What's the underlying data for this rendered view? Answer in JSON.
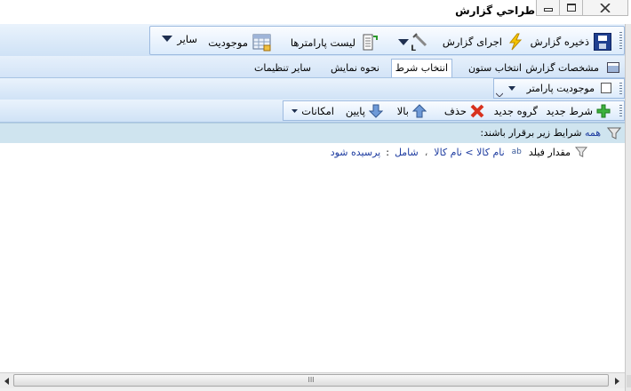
{
  "window": {
    "title": "طراحي گزارش"
  },
  "toolbar": {
    "save_report": "ذخیره گزارش",
    "run_report": "اجرای گزارش",
    "param_list": "لیست پارامترها",
    "entity": "موجودیت",
    "other": "سایر"
  },
  "tabs": [
    "مشخصات گزارش",
    "انتخاب ستون",
    "انتخاب شرط",
    "نحوه نمایش",
    "سایر تنظیمات"
  ],
  "param_bar": {
    "label": "موجودیت پارامتر"
  },
  "condition_bar": {
    "new_condition": "شرط جدید",
    "new_group": "گروه جدید",
    "delete": "حذف",
    "up": "بالا",
    "down": "پایین",
    "options": "امکانات"
  },
  "filter": {
    "all": "همه",
    "header_text": "شرایط زیر برقرار باشند:",
    "field_value_label": "مقدار فیلد",
    "field_path": "نام کالا > نام کالا",
    "comma": "،",
    "operator": "شامل",
    "colon": ":",
    "value": "پرسیده شود"
  },
  "scroll": {
    "thumb_glyph": "III"
  }
}
